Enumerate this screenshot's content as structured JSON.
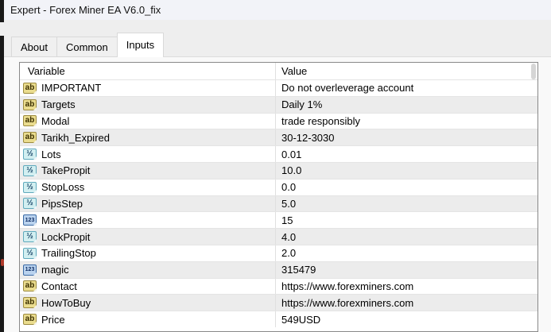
{
  "window": {
    "title": "Expert - Forex Miner EA V6.0_fix"
  },
  "tabs": [
    {
      "label": "About",
      "active": false
    },
    {
      "label": "Common",
      "active": false
    },
    {
      "label": "Inputs",
      "active": true
    }
  ],
  "icons": {
    "ab": "ab",
    "half": "½",
    "num": "123"
  },
  "table": {
    "columns": [
      "Variable",
      "Value"
    ],
    "rows": [
      {
        "icon": "ab",
        "name": "IMPORTANT",
        "value": "Do not overleverage account"
      },
      {
        "icon": "ab",
        "name": "Targets",
        "value": "Daily 1%"
      },
      {
        "icon": "ab",
        "name": "Modal",
        "value": "trade responsibly"
      },
      {
        "icon": "ab",
        "name": "Tarikh_Expired",
        "value": "30-12-3030"
      },
      {
        "icon": "half",
        "name": "Lots",
        "value": "0.01"
      },
      {
        "icon": "half",
        "name": "TakePropit",
        "value": "10.0"
      },
      {
        "icon": "half",
        "name": "StopLoss",
        "value": "0.0"
      },
      {
        "icon": "half",
        "name": "PipsStep",
        "value": "5.0"
      },
      {
        "icon": "num",
        "name": "MaxTrades",
        "value": "15"
      },
      {
        "icon": "half",
        "name": "LockPropit",
        "value": "4.0"
      },
      {
        "icon": "half",
        "name": "TrailingStop",
        "value": "2.0"
      },
      {
        "icon": "num",
        "name": "magic",
        "value": "315479"
      },
      {
        "icon": "ab",
        "name": "Contact",
        "value": "https://www.forexminers.com"
      },
      {
        "icon": "ab",
        "name": "HowToBuy",
        "value": "https://www.forexminers.com"
      },
      {
        "icon": "ab",
        "name": "Price",
        "value": "549USD"
      }
    ]
  },
  "colors": {
    "titlebar": "#f2f3f8",
    "dialog": "#eeeeee",
    "tabpage": "#f9f9f9",
    "stripe": "#ececec",
    "table_border": "#898989",
    "icon_ab_bg": "#eadc8e",
    "icon_half_bg": "#d2eff1",
    "icon_num_bg": "#b9d2ee"
  }
}
